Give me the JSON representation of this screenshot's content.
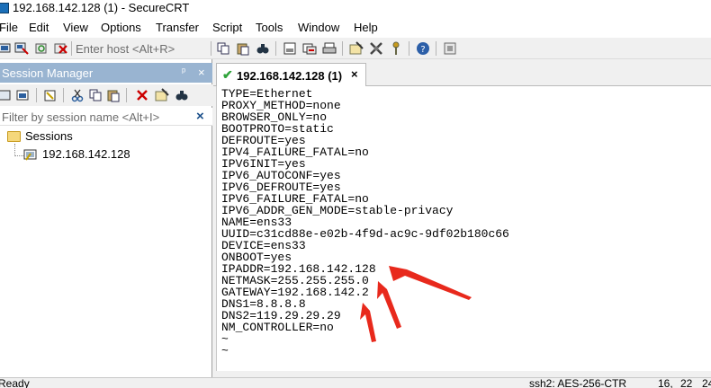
{
  "window": {
    "title": "192.168.142.128 (1) - SecureCRT"
  },
  "menu": [
    "File",
    "Edit",
    "View",
    "Options",
    "Transfer",
    "Script",
    "Tools",
    "Window",
    "Help"
  ],
  "toolbar": {
    "host_placeholder": "Enter host <Alt+R>"
  },
  "session_manager": {
    "title": "Session Manager",
    "pin_glyph": "ᵖ",
    "close_glyph": "×",
    "filter_placeholder": "Filter by session name <Alt+I>",
    "clear_glyph": "×",
    "root_label": "Sessions",
    "session_label": "192.168.142.128"
  },
  "tab": {
    "check_glyph": "✔",
    "label": "192.168.142.128 (1)",
    "close_glyph": "×"
  },
  "terminal": {
    "lines": [
      "TYPE=Ethernet",
      "PROXY_METHOD=none",
      "BROWSER_ONLY=no",
      "BOOTPROTO=static",
      "DEFROUTE=yes",
      "IPV4_FAILURE_FATAL=no",
      "IPV6INIT=yes",
      "IPV6_AUTOCONF=yes",
      "IPV6_DEFROUTE=yes",
      "IPV6_FAILURE_FATAL=no",
      "IPV6_ADDR_GEN_MODE=stable-privacy",
      "NAME=ens33",
      "UUID=c31cd88e-e02b-4f9d-ac9c-9df02b180c66",
      "DEVICE=ens33",
      "ONBOOT=yes",
      "IPADDR=192.168.142.128",
      "NETMASK=255.255.255.0",
      "GATEWAY=192.168.142.2",
      "DNS1=8.8.8.8",
      "DNS2=119.29.29.29",
      "NM_CONTROLLER=no",
      "~",
      "~"
    ]
  },
  "status": {
    "left": "Ready",
    "encryption": "ssh2: AES-256-CTR",
    "row": "16,",
    "col": "22",
    "rows": "24"
  },
  "colors": {
    "annotation_arrow": "#e8291c",
    "check": "#2fa33a",
    "panel_header": "#99b4d1"
  }
}
